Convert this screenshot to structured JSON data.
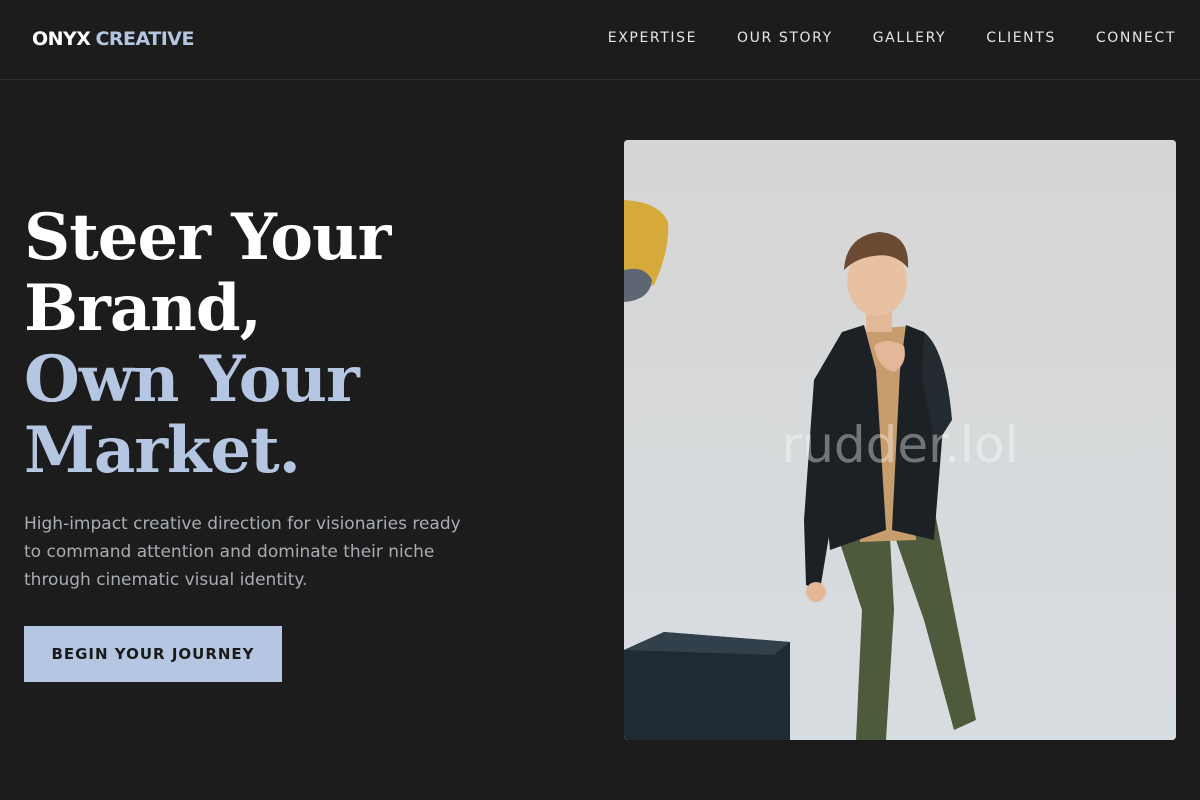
{
  "header": {
    "logo_part1": "ONYX",
    "logo_part2": "CREATIVE",
    "nav": [
      "EXPERTISE",
      "OUR STORY",
      "GALLERY",
      "CLIENTS",
      "CONNECT"
    ]
  },
  "hero": {
    "headline_white": [
      "Steer Your",
      "Brand,"
    ],
    "headline_accent": [
      "Own Your",
      "Market."
    ],
    "subtext": "High-impact creative direction for visionaries ready to command attention and dominate their niche through cinematic visual identity.",
    "cta_label": "BEGIN YOUR JOURNEY",
    "image_watermark": "rudder.lol"
  },
  "colors": {
    "background": "#1c1c1c",
    "accent": "#b4c6e1",
    "text": "#ffffff",
    "muted_text": "#a8adb4"
  }
}
